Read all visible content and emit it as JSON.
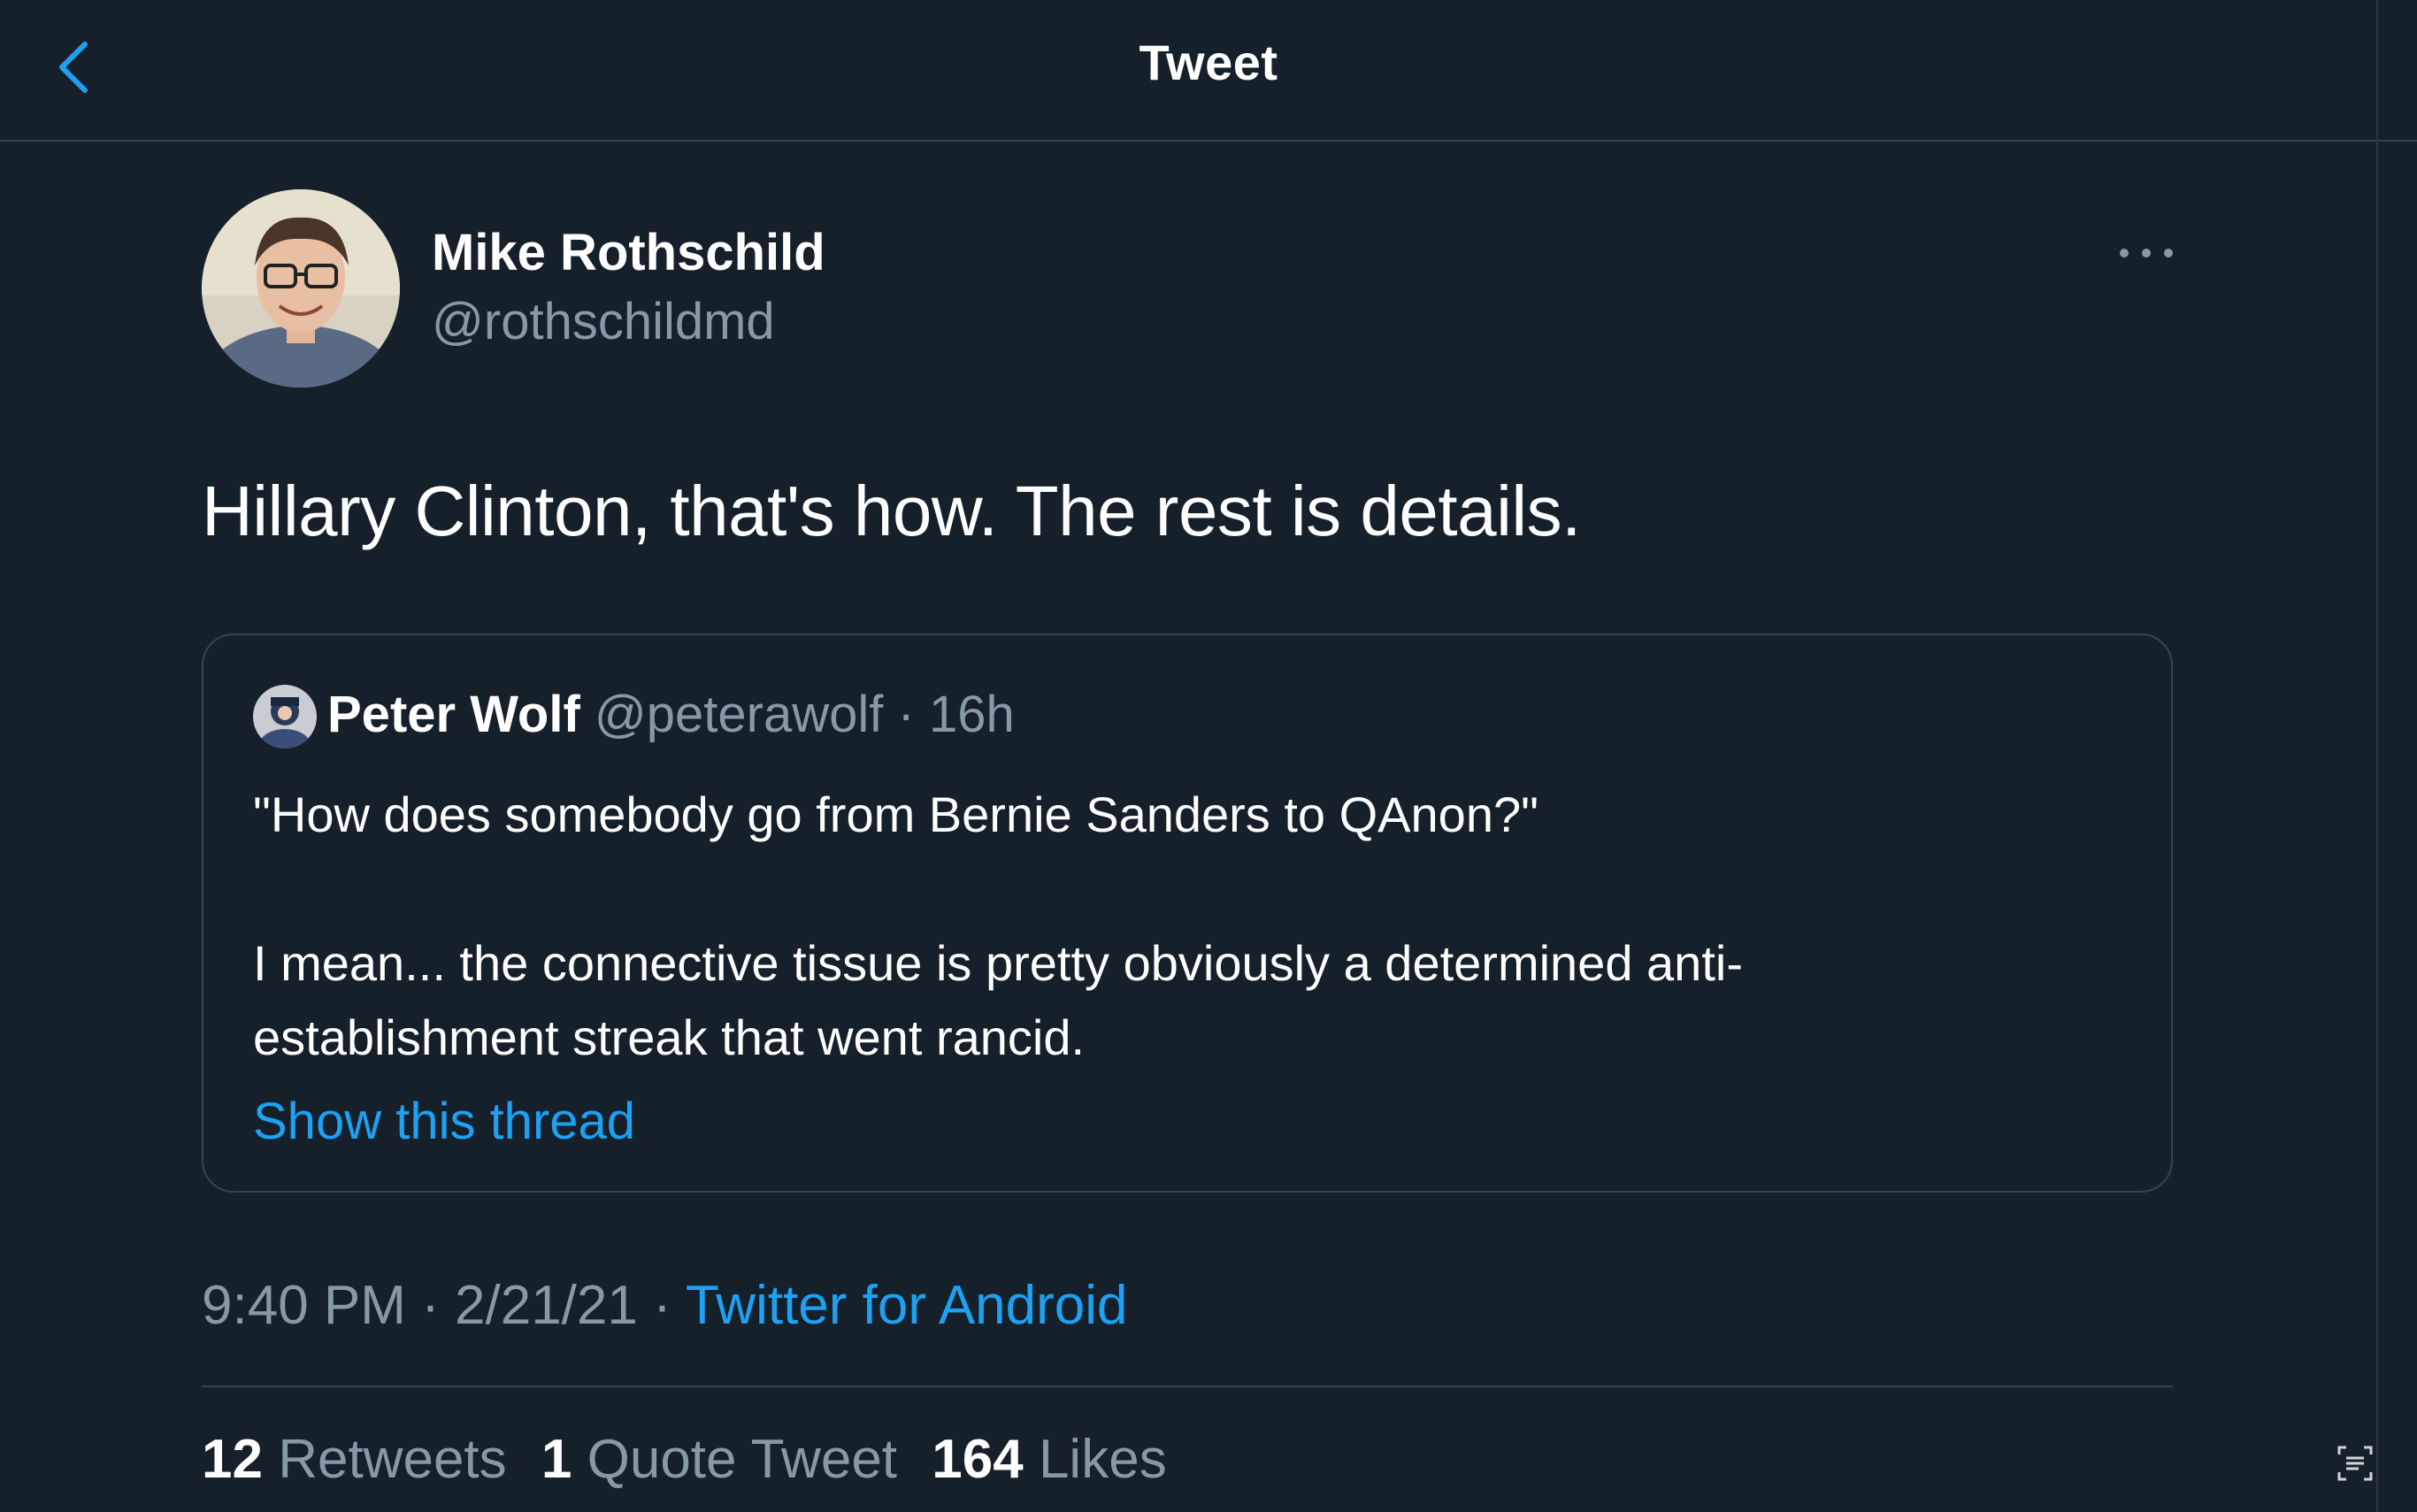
{
  "header": {
    "title": "Tweet",
    "back_icon": "chevron-left-icon",
    "accent": "#1da1f2"
  },
  "tweet": {
    "author_name": "Mike Rothschild",
    "author_handle": "@rothschildmd",
    "text": "Hillary Clinton, that's how. The rest is details.",
    "time": "9:40 PM",
    "sep1": " · ",
    "date": "2/21/21",
    "sep2": " · ",
    "source": "Twitter for Android"
  },
  "quoted": {
    "name": "Peter Wolf",
    "handle": "@peterawolf",
    "dot": "·",
    "age": "16h",
    "line1": "\"How does somebody go from Bernie Sanders to QAnon?\"",
    "line2": "I mean... the connective tissue is pretty obviously a determined anti-",
    "line3": "establishment streak that went rancid.",
    "link": "Show this thread"
  },
  "stats": {
    "retweets_count": "12",
    "retweets_label": "Retweets",
    "quotes_count": "1",
    "quotes_label": "Quote Tweet",
    "likes_count": "164",
    "likes_label": "Likes"
  },
  "colors": {
    "background": "#15202b",
    "border": "#38444d",
    "muted": "#8899a6",
    "link": "#1da1f2"
  }
}
